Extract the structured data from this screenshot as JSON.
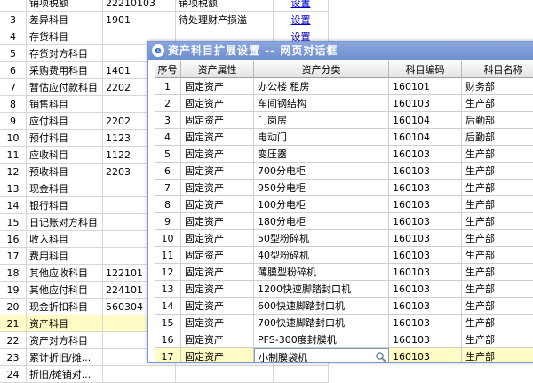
{
  "background_table": {
    "settings_label": "设置",
    "rows": [
      {
        "no": "",
        "name": "销项税额",
        "code": "22210103",
        "extra": "销项税额",
        "settings": "设置"
      },
      {
        "no": "3",
        "name": "差异科目",
        "code": "1901",
        "extra": "待处理财产损溢",
        "settings": "设置"
      },
      {
        "no": "4",
        "name": "存货科目",
        "code": "",
        "extra": "",
        "settings": "设置"
      },
      {
        "no": "5",
        "name": "存货对方科目",
        "code": "",
        "extra": "",
        "settings": ""
      },
      {
        "no": "6",
        "name": "采购费用科目",
        "code": "1401",
        "extra": "",
        "settings": ""
      },
      {
        "no": "7",
        "name": "暂估应付款科目",
        "code": "2202",
        "extra": "",
        "settings": ""
      },
      {
        "no": "8",
        "name": "销售科目",
        "code": "",
        "extra": "",
        "settings": ""
      },
      {
        "no": "9",
        "name": "应付科目",
        "code": "2202",
        "extra": "",
        "settings": ""
      },
      {
        "no": "10",
        "name": "预付科目",
        "code": "1123",
        "extra": "",
        "settings": ""
      },
      {
        "no": "11",
        "name": "应收科目",
        "code": "1122",
        "extra": "",
        "settings": ""
      },
      {
        "no": "12",
        "name": "预收科目",
        "code": "2203",
        "extra": "",
        "settings": ""
      },
      {
        "no": "13",
        "name": "现金科目",
        "code": "",
        "extra": "",
        "settings": ""
      },
      {
        "no": "14",
        "name": "银行科目",
        "code": "",
        "extra": "",
        "settings": ""
      },
      {
        "no": "15",
        "name": "日记账对方科目",
        "code": "",
        "extra": "",
        "settings": ""
      },
      {
        "no": "16",
        "name": "收入科目",
        "code": "",
        "extra": "",
        "settings": ""
      },
      {
        "no": "17",
        "name": "费用科目",
        "code": "",
        "extra": "",
        "settings": ""
      },
      {
        "no": "18",
        "name": "其他应收科目",
        "code": "122101",
        "extra": "",
        "settings": ""
      },
      {
        "no": "19",
        "name": "其他应付科目",
        "code": "224101",
        "extra": "",
        "settings": ""
      },
      {
        "no": "20",
        "name": "现金折扣科目",
        "code": "560304",
        "extra": "",
        "settings": ""
      },
      {
        "no": "21",
        "name": "资产科目",
        "code": "",
        "extra": "",
        "settings": ""
      },
      {
        "no": "22",
        "name": "资产对方科目",
        "code": "",
        "extra": "",
        "settings": ""
      },
      {
        "no": "23",
        "name": "累计折旧/摊...",
        "code": "",
        "extra": "",
        "settings": ""
      },
      {
        "no": "24",
        "name": "折旧/摊销对...",
        "code": "",
        "extra": "",
        "settings": ""
      }
    ]
  },
  "dialog": {
    "title": "资产科目扩展设置 -- 网页对话框",
    "icon": "ie-logo-icon",
    "columns": [
      "序号",
      "资产属性",
      "资产分类",
      "科目编码",
      "科目名称"
    ],
    "rows": [
      {
        "no": "1",
        "attr": "固定资产",
        "category": "办公楼 租房",
        "code": "160101",
        "name": "财务部"
      },
      {
        "no": "2",
        "attr": "固定资产",
        "category": "车间钢结构",
        "code": "160103",
        "name": "生产部"
      },
      {
        "no": "3",
        "attr": "固定资产",
        "category": "门岗房",
        "code": "160104",
        "name": "后勤部"
      },
      {
        "no": "4",
        "attr": "固定资产",
        "category": "电动门",
        "code": "160104",
        "name": "后勤部"
      },
      {
        "no": "5",
        "attr": "固定资产",
        "category": "变压器",
        "code": "160103",
        "name": "生产部"
      },
      {
        "no": "6",
        "attr": "固定资产",
        "category": "700分电柜",
        "code": "160103",
        "name": "生产部"
      },
      {
        "no": "7",
        "attr": "固定资产",
        "category": "950分电柜",
        "code": "160103",
        "name": "生产部"
      },
      {
        "no": "8",
        "attr": "固定资产",
        "category": "100分电柜",
        "code": "160103",
        "name": "生产部"
      },
      {
        "no": "9",
        "attr": "固定资产",
        "category": "180分电柜",
        "code": "160103",
        "name": "生产部"
      },
      {
        "no": "10",
        "attr": "固定资产",
        "category": "50型粉碎机",
        "code": "160103",
        "name": "生产部"
      },
      {
        "no": "11",
        "attr": "固定资产",
        "category": "40型粉碎机",
        "code": "160103",
        "name": "生产部"
      },
      {
        "no": "12",
        "attr": "固定资产",
        "category": "薄膜型粉碎机",
        "code": "160103",
        "name": "生产部"
      },
      {
        "no": "13",
        "attr": "固定资产",
        "category": "1200快速脚踏封口机",
        "code": "160103",
        "name": "生产部"
      },
      {
        "no": "14",
        "attr": "固定资产",
        "category": "600快速脚踏封口机",
        "code": "160103",
        "name": "生产部"
      },
      {
        "no": "15",
        "attr": "固定资产",
        "category": "700快速脚踏封口机",
        "code": "160103",
        "name": "生产部"
      },
      {
        "no": "16",
        "attr": "固定资产",
        "category": "PFS-300度封膜机",
        "code": "160103",
        "name": "生产部"
      },
      {
        "no": "17",
        "attr": "固定资产",
        "category": "小制膜袋机",
        "code": "160103",
        "name": "生产部"
      }
    ],
    "selected_row": "17",
    "search_icon": "magnifier-icon"
  }
}
